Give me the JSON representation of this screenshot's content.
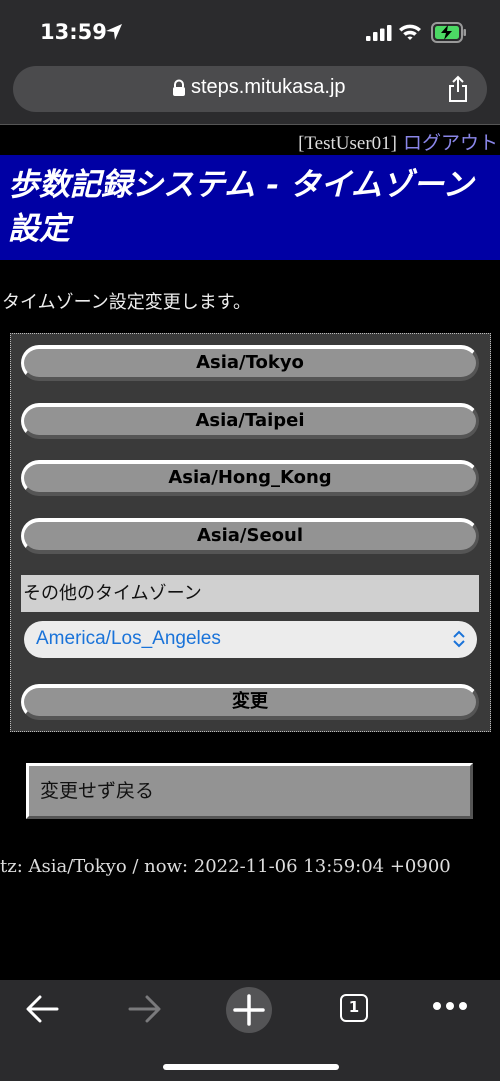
{
  "status_bar": {
    "time": "13:59",
    "icons": [
      "location-arrow-icon",
      "signal-icon",
      "wifi-icon",
      "battery-charging-icon"
    ]
  },
  "address_bar": {
    "url": "steps.mitukasa.jp",
    "icons": [
      "lock-icon",
      "share-icon"
    ]
  },
  "header": {
    "user": "[TestUser01]",
    "logout_label": "ログアウト"
  },
  "page_title": "歩数記録システム - タイムゾーン設定",
  "intro_text": "タイムゾーン設定変更します。",
  "timezone_form": {
    "buttons": [
      "Asia/Tokyo",
      "Asia/Taipei",
      "Asia/Hong_Kong",
      "Asia/Seoul"
    ],
    "other_label": "その他のタイムゾーン",
    "selected_timezone": "America/Los_Angeles",
    "submit_label": "変更"
  },
  "back_button_label": "変更せず戻る",
  "footer_info": "tz: Asia/Tokyo / now: 2022-11-06 13:59:04 +0900",
  "toolbar": {
    "tab_count": "1",
    "icons": [
      "back-arrow-icon",
      "forward-arrow-icon",
      "plus-icon",
      "tabs-icon",
      "more-icon"
    ]
  },
  "colors": {
    "title_band": "#0000a4",
    "logout_link": "#8a86e8",
    "select_text": "#1a73d9",
    "button_face": "#939393",
    "chrome": "#2b2b2d"
  }
}
